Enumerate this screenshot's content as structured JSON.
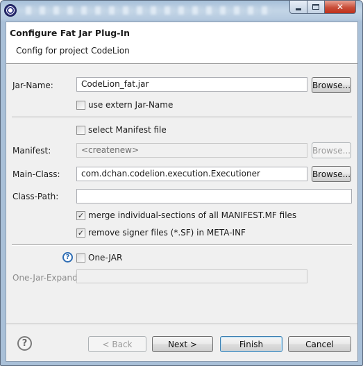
{
  "window": {
    "icon": "eclipse-icon",
    "controls": {
      "minimize": "minimize-icon",
      "maximize": "maximize-icon",
      "close": "close-icon"
    }
  },
  "banner": {
    "title": "Configure Fat Jar Plug-In",
    "subtitle": "Config for project CodeLion"
  },
  "form": {
    "jar_name": {
      "label": "Jar-Name:",
      "value": "CodeLion_fat.jar",
      "browse": "Browse..."
    },
    "use_extern": {
      "label": "use extern Jar-Name",
      "checked": false
    },
    "select_manifest": {
      "label": "select Manifest file",
      "checked": false
    },
    "manifest": {
      "label": "Manifest:",
      "value": "<createnew>",
      "browse": "Browse..."
    },
    "main_class": {
      "label": "Main-Class:",
      "value": "com.dchan.codelion.execution.Executioner",
      "browse": "Browse..."
    },
    "class_path": {
      "label": "Class-Path:",
      "value": ""
    },
    "merge_sections": {
      "label": "merge individual-sections of all MANIFEST.MF files",
      "checked": true
    },
    "remove_signer": {
      "label": "remove signer files (*.SF) in META-INF",
      "checked": true
    },
    "one_jar": {
      "label": "One-JAR",
      "checked": false,
      "help_icon": "help-icon"
    },
    "one_jar_expand": {
      "label": "One-Jar-Expand:",
      "value": ""
    }
  },
  "footer": {
    "help_icon": "help-icon",
    "back": "< Back",
    "next": "Next >",
    "finish": "Finish",
    "cancel": "Cancel"
  }
}
